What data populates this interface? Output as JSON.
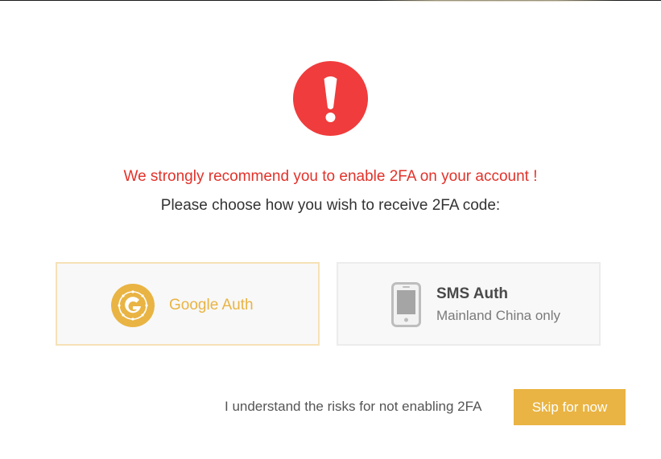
{
  "alert": {
    "icon": "exclamation-circle-icon",
    "color": "#f03c3c"
  },
  "headline": "We strongly recommend you to enable 2FA on your account !",
  "subline": "Please choose how you wish to receive 2FA code:",
  "options": [
    {
      "icon": "google-authenticator-icon",
      "label": "Google Auth",
      "accent": "#e9b443"
    },
    {
      "icon": "smartphone-icon",
      "label": "SMS Auth",
      "sublabel": "Mainland China only"
    }
  ],
  "footer": {
    "risk_text": "I understand the risks for not enabling 2FA",
    "skip_label": "Skip for now"
  },
  "colors": {
    "warning": "#e2322a",
    "brand": "#e9b443"
  }
}
